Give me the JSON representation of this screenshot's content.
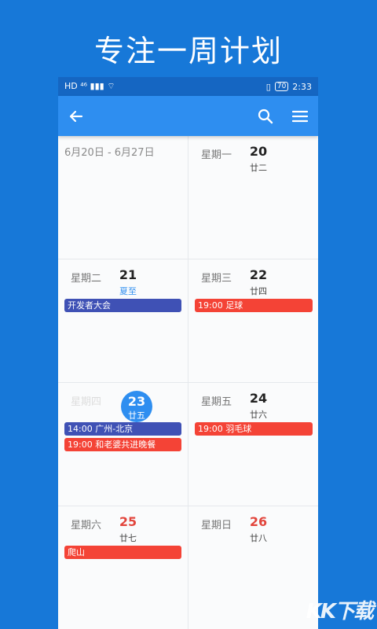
{
  "promo": {
    "title": "专注一周计划"
  },
  "status_bar": {
    "left": "HD ⁴⁶ ▮▮▮ ⌔",
    "battery": "70",
    "time": "2:33"
  },
  "range": "6月20日 - 6月27日",
  "days": [
    {
      "weekday": "星期一",
      "date": "20",
      "lunar": "廿二",
      "events": []
    },
    {
      "weekday": "星期二",
      "date": "21",
      "lunar": "夏至",
      "events": [
        {
          "text": "开发者大会"
        }
      ]
    },
    {
      "weekday": "星期三",
      "date": "22",
      "lunar": "廿四",
      "events": [
        {
          "text": "19:00  足球"
        }
      ]
    },
    {
      "weekday": "星期四",
      "date": "23",
      "lunar": "廿五",
      "events": [
        {
          "text": "14:00  广州-北京"
        },
        {
          "text": "19:00  和老婆共进晚餐"
        }
      ]
    },
    {
      "weekday": "星期五",
      "date": "24",
      "lunar": "廿六",
      "events": [
        {
          "text": "19:00  羽毛球"
        }
      ]
    },
    {
      "weekday": "星期六",
      "date": "25",
      "lunar": "廿七",
      "events": [
        {
          "text": "爬山"
        }
      ]
    },
    {
      "weekday": "星期日",
      "date": "26",
      "lunar": "廿八",
      "events": []
    }
  ],
  "watermark": "KK下载",
  "colors": {
    "primary": "#2E8EF0",
    "event_blue": "#3F51B5",
    "event_red": "#F44336",
    "weekend": "#E2463D"
  }
}
